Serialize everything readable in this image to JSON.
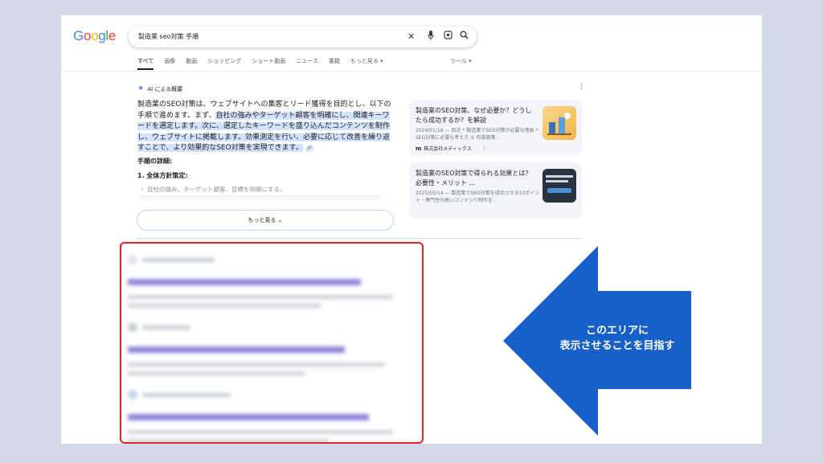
{
  "logo": {
    "letters": [
      "G",
      "o",
      "o",
      "g",
      "l",
      "e"
    ],
    "colors": [
      "#4285f4",
      "#ea4335",
      "#fbbc05",
      "#4285f4",
      "#34a853",
      "#ea4335"
    ]
  },
  "search": {
    "query": "製造業 seo対策 手順"
  },
  "icons": {
    "clear": "close-icon",
    "mic": "mic-icon",
    "lens": "lens-icon",
    "search": "search-icon"
  },
  "tabs": [
    "すべて",
    "画像",
    "動画",
    "ショッピング",
    "ショート動画",
    "ニュース",
    "書籍",
    "もっと見る ▾"
  ],
  "tools_label": "ツール ▾",
  "ai": {
    "heading": "AI による概要",
    "body_plain": "製造業のSEO対策は、ウェブサイトへの集客とリード獲得を目的とし、以下の手順で進めます。まず、",
    "body_highlight": "自社の強みやターゲット顧客を明確にし、関連キーワードを選定します。次に、選定したキーワードを盛り込んだコンテンツを制作し、ウェブサイトに掲載します。効果測定を行い、必要に応じて改善を繰り返すことで、より効果的なSEO対策を実現できます。",
    "sub1": "手順の詳細:",
    "sub2": "1. 全体方針策定:",
    "bullet": "・ 自社の強み、ターゲット顧客、目標を明確にする。",
    "more_button": "もっと見る ⌄"
  },
  "cards": [
    {
      "title": "製造業のSEO対策、なぜ必要か？どうしたら成功するか？を解説",
      "snippet": "2024/01/18 — 目次 * 製造業でSEO対策が必要な理由 * SEO対策に必要な考え方 ① 内部施策...",
      "source": "株式会社メディックス",
      "accent": "#f5c45e"
    },
    {
      "title": "製造業のSEO対策で得られる効果とは？必要性・メリット ...",
      "snippet": "2025/05/14 — 製造業でSEO対策を成功させる10ポイント・専門性の高いコンテンツ制作を...",
      "source": "",
      "accent": "#2a3340"
    }
  ],
  "callout": {
    "line1": "このエリアに",
    "line2": "表示させることを目指す",
    "color": "#1660c8",
    "box_color": "#e0242c"
  }
}
